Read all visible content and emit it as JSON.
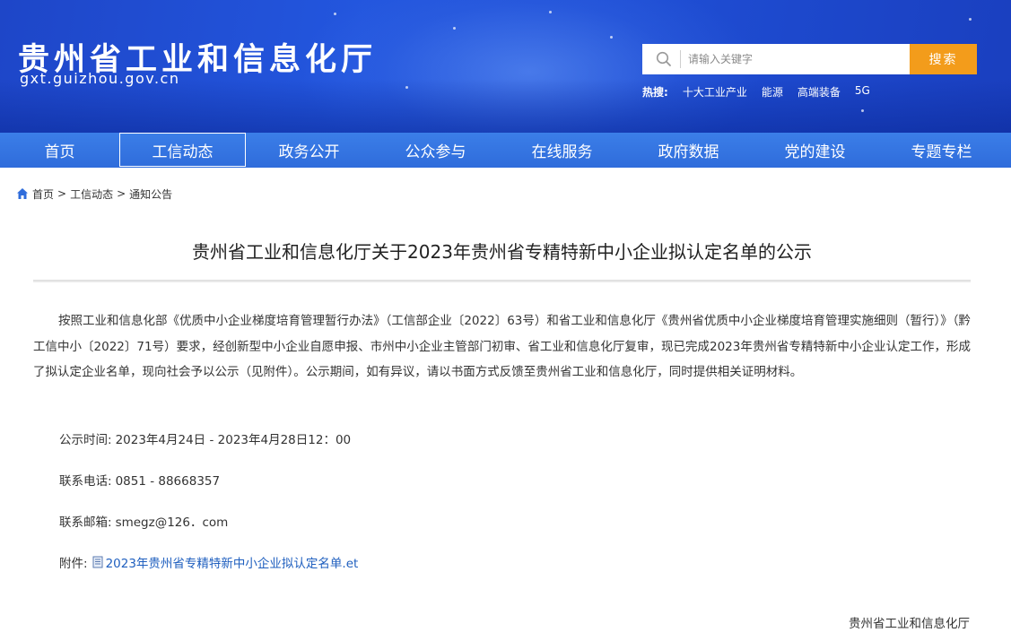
{
  "header": {
    "site_title": "贵州省工业和信息化厅",
    "site_domain": "gxt.guizhou.gov.cn",
    "search_placeholder": "请输入关键字",
    "search_button": "搜索",
    "hot_label": "热搜:",
    "hot_items": [
      "十大工业产业",
      "能源",
      "高端装备",
      "5G"
    ]
  },
  "nav": {
    "items": [
      "首页",
      "工信动态",
      "政务公开",
      "公众参与",
      "在线服务",
      "政府数据",
      "党的建设",
      "专题专栏"
    ],
    "active_index": 1
  },
  "breadcrumb": {
    "home": "首页",
    "sep": ">",
    "level1": "工信动态",
    "level2": "通知公告"
  },
  "article": {
    "title": "贵州省工业和信息化厅关于2023年贵州省专精特新中小企业拟认定名单的公示",
    "body": "按照工业和信息化部《优质中小企业梯度培育管理暂行办法》（工信部企业〔2022〕63号）和省工业和信息化厅《贵州省优质中小企业梯度培育管理实施细则（暂行）》（黔工信中小〔2022〕71号）要求，经创新型中小企业自愿申报、市州中小企业主管部门初审、省工业和信息化厅复审，现已完成2023年贵州省专精特新中小企业认定工作，形成了拟认定企业名单，现向社会予以公示（见附件）。公示期间，如有异议，请以书面方式反馈至贵州省工业和信息化厅，同时提供相关证明材料。",
    "time_label": "公示时间:",
    "time_value": "2023年4月24日 - 2023年4月28日12：00",
    "phone_label": "联系电话:",
    "phone_value": "0851 - 88668357",
    "email_label": "联系邮箱:",
    "email_value": "smegz@126．com",
    "attach_label": "附件:",
    "attach_link": "2023年贵州省专精特新中小企业拟认定名单.et",
    "signature": "贵州省工业和信息化厅"
  },
  "colors": {
    "banner": "#2356de",
    "nav": "#3477e3",
    "search_button": "#f39c1b",
    "link": "#1f5fbf"
  }
}
